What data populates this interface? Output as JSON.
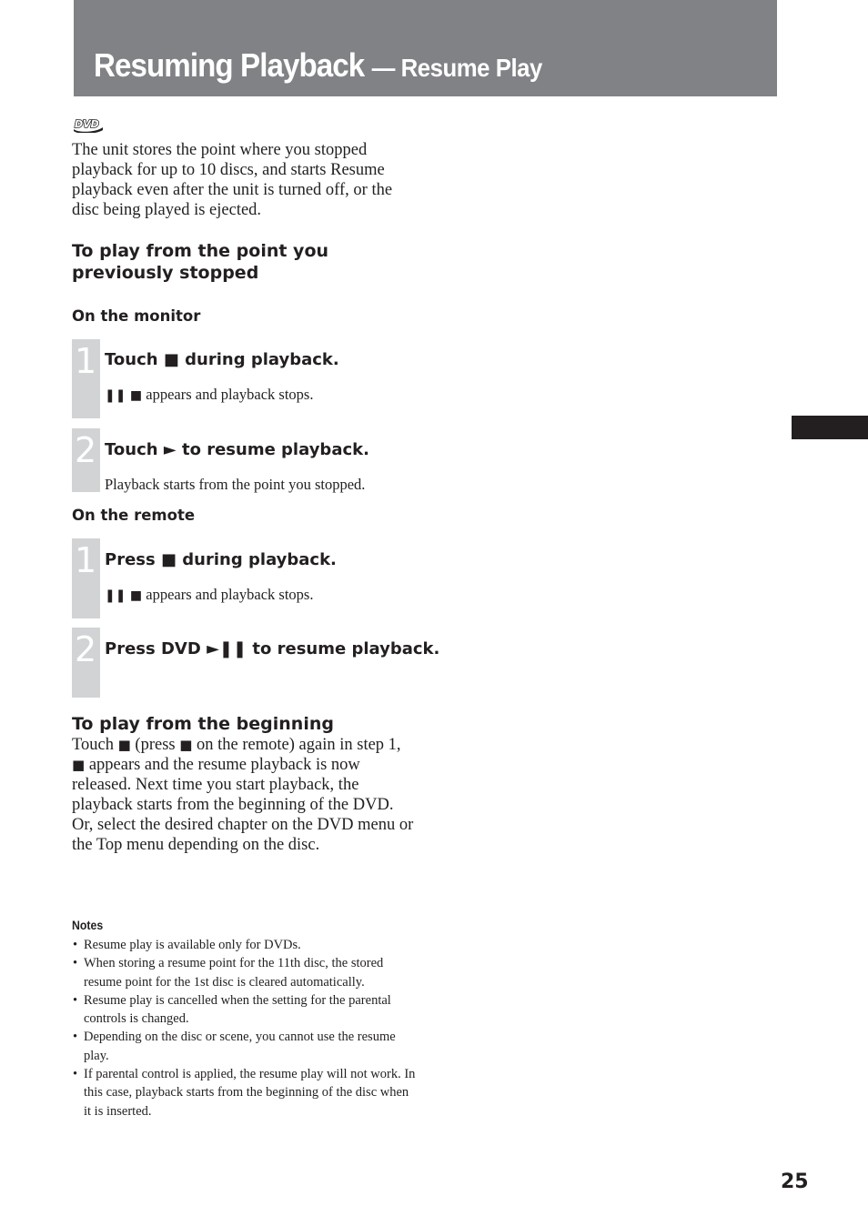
{
  "header": {
    "title_main": "Resuming Playback",
    "title_sub": "— Resume Play"
  },
  "dvd_badge": {
    "label": "DVD",
    "icon": "dvd-logo-icon"
  },
  "intro": "The unit stores the point where you stopped playback for up to 10 discs, and starts Resume playback even after the unit is turned off, or the disc being played is ejected.",
  "section_resume": {
    "heading_line1": "To play from the point you",
    "heading_line2": "previously stopped",
    "monitor": {
      "heading": "On the monitor",
      "steps": [
        {
          "number": "1",
          "title_pre": "Touch",
          "title_icon": "■",
          "title_post": "during playback.",
          "desc_icons": "❚❚ ■",
          "desc": "appears and playback stops."
        },
        {
          "number": "2",
          "title_pre": "Touch",
          "title_icon": "►",
          "title_post": "to resume playback.",
          "desc": "Playback starts from the point you stopped."
        }
      ]
    },
    "remote": {
      "heading": "On the remote",
      "steps": [
        {
          "number": "1",
          "title_pre": "Press",
          "title_icon": "■",
          "title_post": "during playback.",
          "desc_icons": "❚❚ ■",
          "desc": "appears and playback stops."
        },
        {
          "number": "2",
          "title_pre": "Press DVD",
          "title_icon": "►❚❚",
          "title_post": "to resume playback."
        }
      ]
    }
  },
  "section_beginning": {
    "heading": "To play from the beginning",
    "para1_a": "Touch",
    "para1_icon1": "■",
    "para1_b": "(press",
    "para1_icon2": "■",
    "para1_c": "on the remote) again in step 1,",
    "para1_icon3": "■",
    "para1_d": "appears and the resume playback is now released. Next time you start playback, the playback starts from the beginning of the DVD.",
    "para2": "Or, select the desired chapter on the DVD menu or the Top menu depending on the disc."
  },
  "notes": {
    "title": "Notes",
    "items": [
      "Resume play is available only for DVDs.",
      "When storing a resume point for the 11th disc, the stored resume point for the 1st disc is cleared automatically.",
      "Resume play is cancelled when the setting for the parental controls is changed.",
      "Depending on the disc or scene, you cannot use the resume play.",
      "If parental control is applied, the resume play will not work. In this case, playback starts from the beginning of the disc when it is inserted."
    ]
  },
  "page_number": "25",
  "colors": {
    "header_band": "#818285",
    "step_bar": "#d1d3d4",
    "text": "#231f20",
    "side_tab": "#231f20"
  }
}
